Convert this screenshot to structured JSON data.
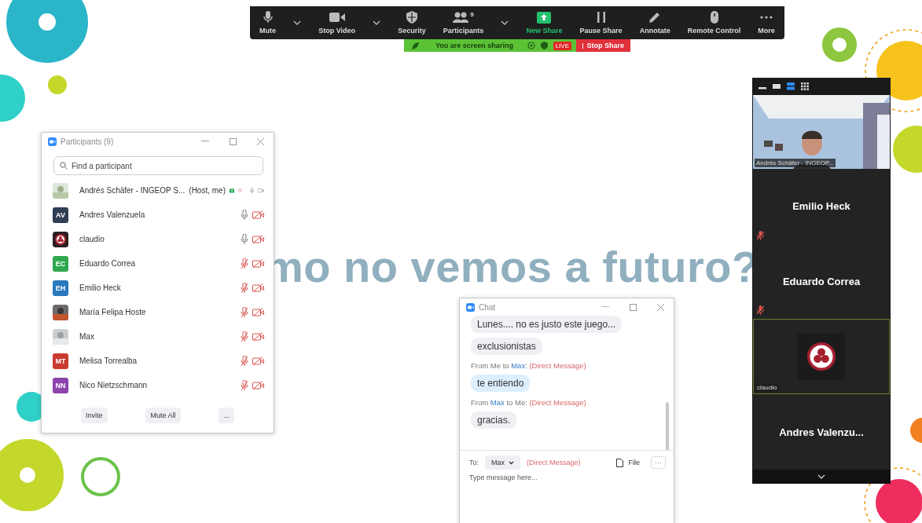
{
  "toolbar": {
    "items": [
      {
        "kind": "mic",
        "label": "Mute",
        "caret": true,
        "highlight": false
      },
      {
        "kind": "camera",
        "label": "Stop Video",
        "caret": true,
        "highlight": false
      },
      {
        "kind": "shield",
        "label": "Security",
        "caret": false,
        "highlight": false
      },
      {
        "kind": "people",
        "label": "Participants",
        "badge": "9",
        "caret": true,
        "highlight": false
      },
      {
        "kind": "share",
        "label": "New Share",
        "caret": false,
        "highlight": true
      },
      {
        "kind": "pause",
        "label": "Pause Share",
        "caret": false,
        "highlight": false
      },
      {
        "kind": "pencil",
        "label": "Annotate",
        "caret": false,
        "highlight": false
      },
      {
        "kind": "mouse",
        "label": "Remote Control",
        "caret": false,
        "highlight": false
      },
      {
        "kind": "dots",
        "label": "More",
        "caret": false,
        "highlight": false
      }
    ]
  },
  "share_bar": {
    "status": "You are screen sharing",
    "live": "LIVE",
    "stop": "Stop Share"
  },
  "slide": {
    "text": "mo no vemos a futuro?"
  },
  "participants_panel": {
    "title": "Participants (9)",
    "search": {
      "placeholder": "Find a participant"
    },
    "participants": [
      {
        "name": "Andrés Schäfer - INGEOP S...",
        "role": "(Host, me)",
        "sharing": true,
        "recording": true,
        "mic_muted": false,
        "video_off": false
      },
      {
        "name": "Andres Valenzuela",
        "avatar": {
          "kind": "initials",
          "initials": "AV",
          "color": "#2f3d55"
        },
        "sharing": false,
        "recording": false,
        "mic_muted": false,
        "video_off": true
      },
      {
        "name": "claudio",
        "avatar": {
          "kind": "emblem"
        },
        "sharing": false,
        "recording": false,
        "mic_muted": false,
        "video_off": true
      },
      {
        "name": "Eduardo Correa",
        "avatar": {
          "kind": "initials",
          "initials": "EC",
          "color": "#2fa84f"
        },
        "sharing": false,
        "recording": false,
        "mic_muted": true,
        "video_off": true
      },
      {
        "name": "Emilio Heck",
        "avatar": {
          "kind": "initials",
          "initials": "EH",
          "color": "#2a78bd"
        },
        "sharing": false,
        "recording": false,
        "mic_muted": true,
        "video_off": true
      },
      {
        "name": "María Felipa Hoste",
        "sharing": false,
        "recording": false,
        "mic_muted": true,
        "video_off": true
      },
      {
        "name": "Max",
        "sharing": false,
        "recording": false,
        "mic_muted": true,
        "video_off": true
      },
      {
        "name": "Melisa Torrealba",
        "avatar": {
          "kind": "initials",
          "initials": "MT",
          "color": "#c93a2f"
        },
        "sharing": false,
        "recording": false,
        "mic_muted": true,
        "video_off": true
      },
      {
        "name": "Nico Nietzschmann",
        "avatar": {
          "kind": "initials",
          "initials": "NN",
          "color": "#8e44ad"
        },
        "sharing": false,
        "recording": false,
        "mic_muted": true,
        "video_off": true
      }
    ],
    "buttons": [
      "Invite",
      "Mute All",
      "..."
    ]
  },
  "chat": {
    "title": "Chat",
    "messages": [
      {
        "kind": "bubble",
        "text": "Lunes.... no es justo este juego...",
        "mine": false
      },
      {
        "kind": "bubble",
        "text": "exclusionistas",
        "mine": false
      },
      {
        "kind": "header",
        "parts": [
          {
            "kind": "plain",
            "text": "From Me to "
          },
          {
            "kind": "name",
            "text": "Max"
          },
          {
            "kind": "plain",
            "text": ": "
          },
          {
            "kind": "note",
            "text": "(Direct Message)"
          }
        ]
      },
      {
        "kind": "bubble",
        "text": "te entiendo",
        "mine": true
      },
      {
        "kind": "header",
        "parts": [
          {
            "kind": "plain",
            "text": "From "
          },
          {
            "kind": "name",
            "text": "Max"
          },
          {
            "kind": "plain",
            "text": " to Me: "
          },
          {
            "kind": "note",
            "text": "(Direct Message)"
          }
        ]
      },
      {
        "kind": "bubble",
        "text": "gracias.",
        "mine": false
      }
    ],
    "to_label": "To:",
    "recipient": "Max",
    "recipient_note": "(Direct Message)",
    "file_button": "File",
    "more_button": "···",
    "input": {
      "placeholder": "Type message here..."
    }
  },
  "video_panel": {
    "view_modes": [
      {
        "kind": "minimize",
        "selected": false
      },
      {
        "kind": "single",
        "selected": false
      },
      {
        "kind": "strip",
        "selected": true
      },
      {
        "kind": "grid",
        "selected": false
      }
    ],
    "tiles": [
      {
        "kind": "video",
        "name": "Andrés Schäfer - INGEOP...",
        "muted": false,
        "active": false
      },
      {
        "kind": "name",
        "name": "Emilio Heck",
        "muted": true,
        "active": false
      },
      {
        "kind": "name",
        "name": "Eduardo Correa",
        "muted": true,
        "active": false
      },
      {
        "kind": "emblem",
        "name": "claudio",
        "muted": false,
        "active": true
      },
      {
        "kind": "name",
        "name": "Andres Valenzu...",
        "muted": false,
        "active": false
      }
    ]
  }
}
